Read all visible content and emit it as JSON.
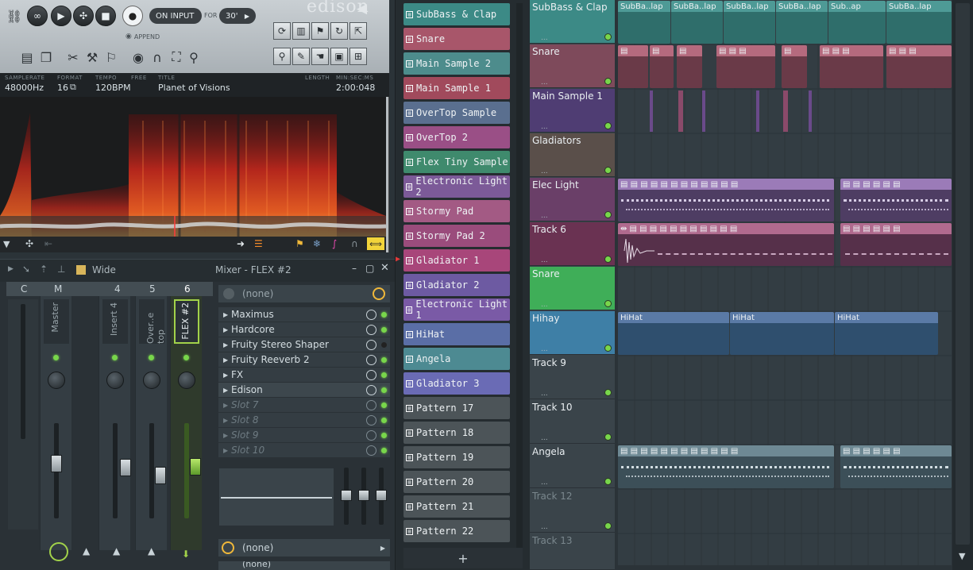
{
  "edison": {
    "watermark": "edison",
    "on_input": "ON INPUT",
    "for_label": "FOR",
    "for_value": "30'",
    "append": "APPEND",
    "info": {
      "samplerate_label": "SAMPLERATE",
      "samplerate": "48000Hz",
      "format_label": "FORMAT",
      "format": "16",
      "tempo_label": "TEMPO",
      "tempo": "120BPM",
      "free_label": "FREE",
      "title_label": "TITLE",
      "title": "Planet of Visions",
      "length_label": "LENGTH",
      "minsec_label": "MIN:SEC:MS",
      "length": "2:00:048"
    }
  },
  "mixer": {
    "wide": "Wide",
    "title": "Mixer - FLEX #2",
    "preset": "(none)",
    "strip_headers": [
      "C",
      "M",
      "4",
      "5",
      "6"
    ],
    "strip_names": [
      "Master",
      "Insert 4",
      "Over..e top",
      "FLEX #2"
    ],
    "fx_slots": [
      "Maximus",
      "Hardcore",
      "Fruity Stereo Shaper",
      "Fruity Reeverb 2",
      "FX",
      "Edison",
      "Slot 7",
      "Slot 8",
      "Slot 9",
      "Slot 10"
    ],
    "bottom_preset": "(none)",
    "bottom_preset2": "(none)"
  },
  "patterns": {
    "items": [
      "SubBass & Clap",
      "Snare",
      "Main Sample 2",
      "Main Sample 1",
      "OverTop Sample",
      "OverTop 2",
      "Flex Tiny Sample",
      "Electronic Light 2",
      "Stormy Pad",
      "Stormy Pad 2",
      "Gladiator 1",
      "Gladiator 2",
      "Electronic Light 1",
      "HiHat",
      "Angela",
      "Gladiator 3",
      "Pattern 17",
      "Pattern 18",
      "Pattern 19",
      "Pattern 20",
      "Pattern 21",
      "Pattern 22"
    ],
    "add": "+"
  },
  "playlist": {
    "tracks": [
      "SubBass & Clap",
      "Snare",
      "Main Sample 1",
      "Gladiators",
      "Elec Light",
      "Track 6",
      "Snare",
      "Hihay",
      "Track 9",
      "Track 10",
      "Angela",
      "Track 12",
      "Track 13"
    ],
    "clip_labels": {
      "subbass": [
        "SubBa..lap",
        "SubBa..lap",
        "SubBa..lap",
        "SubBa..lap",
        "Sub..ap",
        "SubBa..lap"
      ],
      "hihat": [
        "HiHat",
        "HiHat",
        "HiHat"
      ]
    },
    "track_dots": "..."
  },
  "colors": {
    "subbass": "#3c8a86",
    "snare": "#a8566a",
    "main2": "#4d8c8c",
    "main1": "#a14a5c",
    "overtop": "#5a6f8f",
    "overtop2": "#9a4f86",
    "flex": "#3f8a6d",
    "elec2": "#7c5a98",
    "stormy": "#a35a84",
    "stormy2": "#9a4c7c",
    "glad1": "#a8467a",
    "glad2": "#6d5aa2",
    "elec1": "#7a5aa6",
    "hihat": "#5a6ea6",
    "angela": "#4d8a92",
    "glad3": "#6a6bb5",
    "empty": "#4c5458",
    "accent": "#78d64b"
  }
}
